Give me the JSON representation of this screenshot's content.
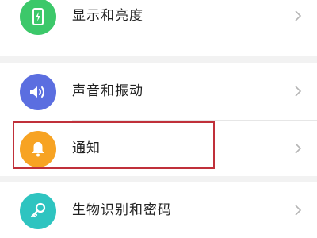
{
  "settings": {
    "items": [
      {
        "label": "显示和亮度",
        "icon": "phone-brightness-icon",
        "color": "#3cc86a"
      },
      {
        "label": "声音和振动",
        "icon": "speaker-icon",
        "color": "#5b6ee0"
      },
      {
        "label": "通知",
        "icon": "bell-icon",
        "color": "#f7a323"
      },
      {
        "label": "生物识别和密码",
        "icon": "key-icon",
        "color": "#2ec4c0"
      }
    ]
  },
  "colors": {
    "background": "#f2f2f2",
    "row": "#ffffff",
    "highlight_border": "#c0303a",
    "chevron": "#b5b5b5"
  }
}
